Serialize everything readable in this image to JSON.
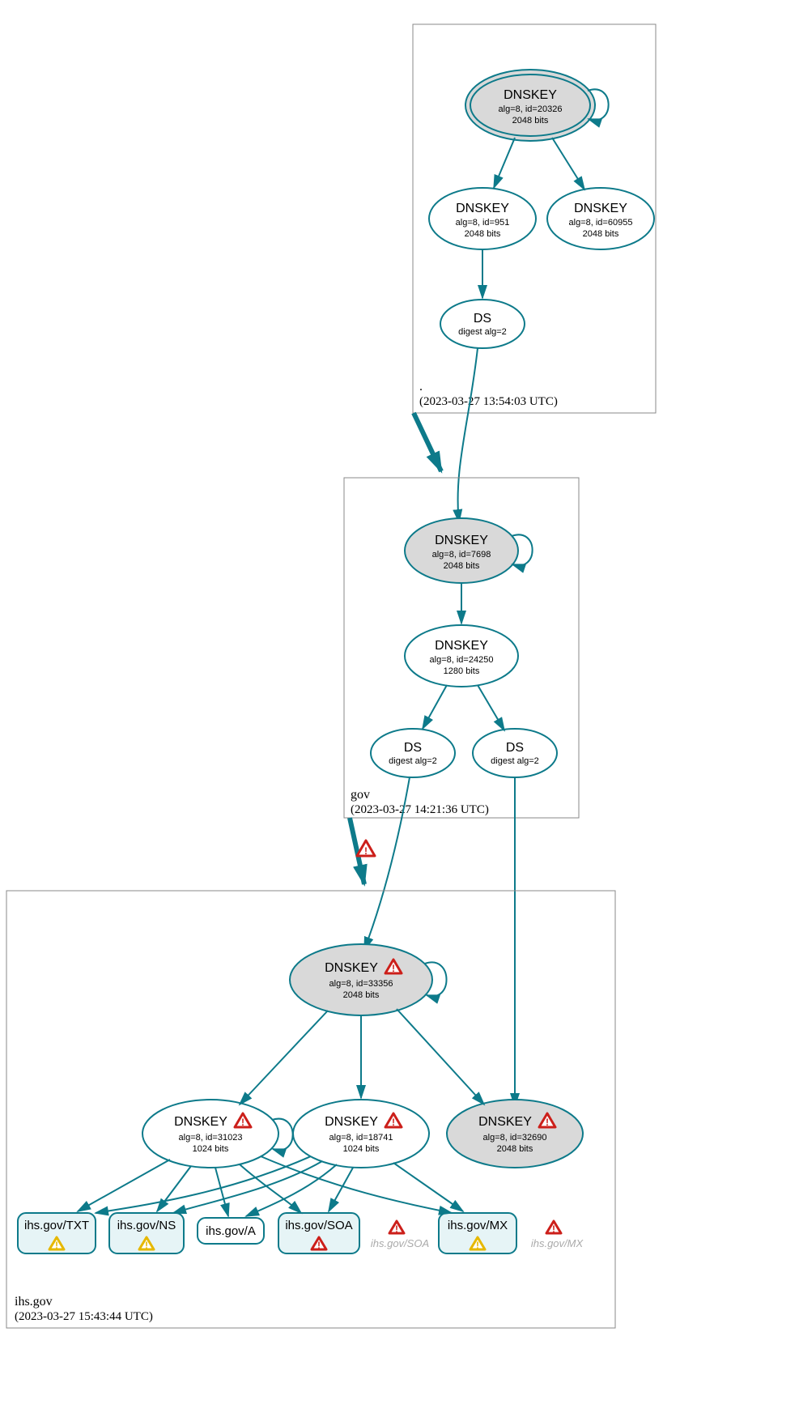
{
  "colors": {
    "stroke": "#0d7a8a",
    "sep_fill": "#d9d9d9",
    "warn_red": "#cc1f1a",
    "warn_yellow": "#e6b800"
  },
  "zones": {
    "root": {
      "name": ".",
      "timestamp": "(2023-03-27 13:54:03 UTC)",
      "nodes": {
        "ksk": {
          "title": "DNSKEY",
          "line1": "alg=8, id=20326",
          "line2": "2048 bits",
          "sep": true,
          "trust_anchor": true
        },
        "zsk1": {
          "title": "DNSKEY",
          "line1": "alg=8, id=951",
          "line2": "2048 bits"
        },
        "zsk2": {
          "title": "DNSKEY",
          "line1": "alg=8, id=60955",
          "line2": "2048 bits"
        },
        "ds": {
          "title": "DS",
          "line1": "digest alg=2"
        }
      }
    },
    "gov": {
      "name": "gov",
      "timestamp": "(2023-03-27 14:21:36 UTC)",
      "nodes": {
        "ksk": {
          "title": "DNSKEY",
          "line1": "alg=8, id=7698",
          "line2": "2048 bits",
          "sep": true
        },
        "zsk": {
          "title": "DNSKEY",
          "line1": "alg=8, id=24250",
          "line2": "1280 bits"
        },
        "ds1": {
          "title": "DS",
          "line1": "digest alg=2"
        },
        "ds2": {
          "title": "DS",
          "line1": "digest alg=2"
        }
      }
    },
    "ihs": {
      "name": "ihs.gov",
      "timestamp": "(2023-03-27 15:43:44 UTC)",
      "nodes": {
        "ksk": {
          "title": "DNSKEY",
          "line1": "alg=8, id=33356",
          "line2": "2048 bits",
          "sep": true,
          "warn": "red"
        },
        "zsk1": {
          "title": "DNSKEY",
          "line1": "alg=8, id=31023",
          "line2": "1024 bits",
          "warn": "red"
        },
        "zsk2": {
          "title": "DNSKEY",
          "line1": "alg=8, id=18741",
          "line2": "1024 bits",
          "warn": "red"
        },
        "zsk3": {
          "title": "DNSKEY",
          "line1": "alg=8, id=32690",
          "line2": "2048 bits",
          "sep": true,
          "warn": "red"
        }
      },
      "rrsets": {
        "txt": {
          "label": "ihs.gov/TXT",
          "warn": "yellow"
        },
        "ns": {
          "label": "ihs.gov/NS",
          "warn": "yellow"
        },
        "a": {
          "label": "ihs.gov/A"
        },
        "soa": {
          "label": "ihs.gov/SOA",
          "warn": "red"
        },
        "mx": {
          "label": "ihs.gov/MX",
          "warn": "yellow"
        }
      },
      "phantom": {
        "soa": {
          "label": "ihs.gov/SOA",
          "warn": "red"
        },
        "mx": {
          "label": "ihs.gov/MX",
          "warn": "red"
        }
      }
    }
  },
  "delegation_warn": "red"
}
